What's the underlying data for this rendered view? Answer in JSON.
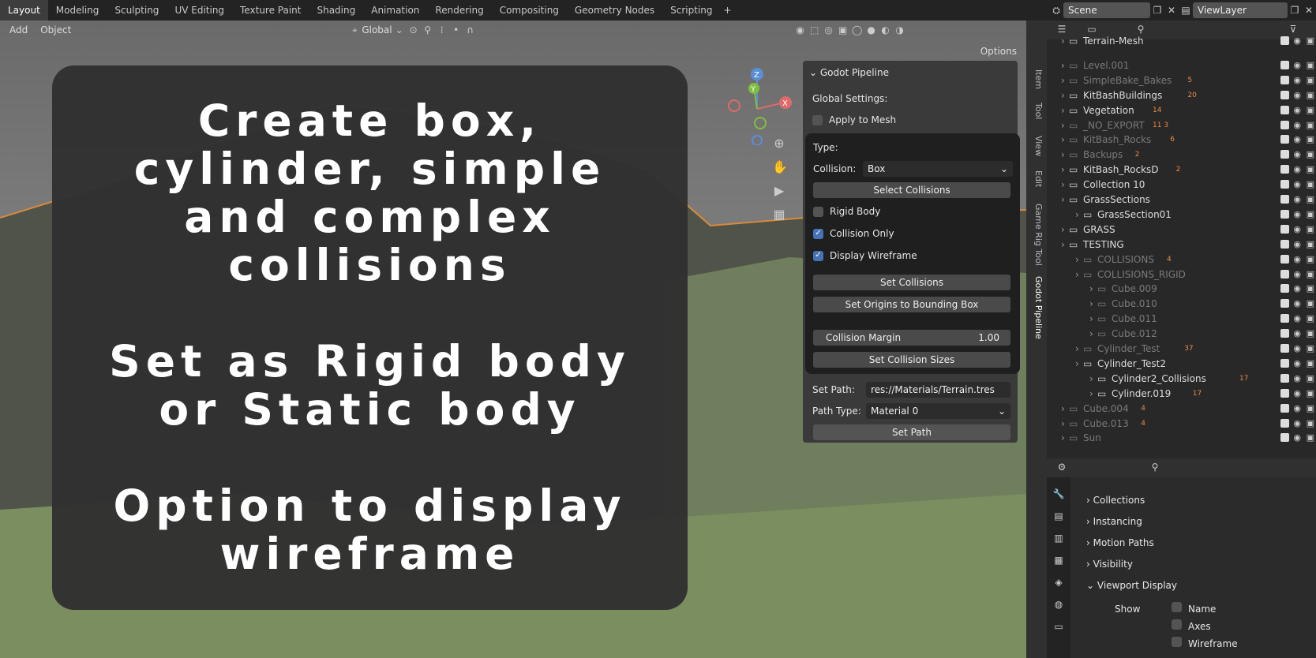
{
  "workspace_tabs": [
    "Layout",
    "Modeling",
    "Sculpting",
    "UV Editing",
    "Texture Paint",
    "Shading",
    "Animation",
    "Rendering",
    "Compositing",
    "Geometry Nodes",
    "Scripting"
  ],
  "add_tab_label": "+",
  "scene": "Scene",
  "view_layer": "ViewLayer",
  "viewport_menu": {
    "add": "Add",
    "object": "Object",
    "transform_orientation": "Global",
    "options": "Options"
  },
  "overlay_lines": [
    "Create box,",
    "cylinder, simple",
    "and complex",
    "collisions",
    "",
    "Set as Rigid body",
    "or Static body",
    "",
    "Option to display",
    "wireframe"
  ],
  "npanel": {
    "title": "Godot Pipeline",
    "global_settings": "Global Settings:",
    "apply_to_mesh": "Apply to Mesh",
    "type_label": "Type:",
    "collision_label": "Collision:",
    "collision_value": "Box",
    "select_collisions": "Select Collisions",
    "rigid_body": "Rigid Body",
    "collision_only": "Collision Only",
    "display_wireframe": "Display Wireframe",
    "set_collisions": "Set Collisions",
    "set_origins": "Set Origins to Bounding Box",
    "collision_margin_label": "Collision Margin",
    "collision_margin_value": "1.00",
    "set_collision_sizes": "Set Collision Sizes",
    "set_path_label": "Set Path:",
    "set_path_value": "res://Materials/Terrain.tres",
    "path_type_label": "Path Type:",
    "path_type_value": "Material 0",
    "set_path_button": "Set Path",
    "checks": {
      "apply_to_mesh": false,
      "rigid_body": false,
      "collision_only": true,
      "display_wireframe": true
    }
  },
  "side_tabs": [
    "Item",
    "Tool",
    "View",
    "Edit",
    "Game Rig Tool",
    "Godot Pipeline"
  ],
  "outliner": [
    {
      "name": "Terrain-Mesh",
      "dim": false
    },
    {
      "name": "Level.001",
      "dim": true
    },
    {
      "name": "SimpleBake_Bakes",
      "dim": true,
      "count": "5"
    },
    {
      "name": "KitBashBuildings",
      "dim": false,
      "count": "20"
    },
    {
      "name": "Vegetation",
      "dim": false,
      "count": "14"
    },
    {
      "name": "_NO_EXPORT",
      "dim": true,
      "count": "11 3"
    },
    {
      "name": "KitBash_Rocks",
      "dim": true,
      "count": "6"
    },
    {
      "name": "Backups",
      "dim": true,
      "count": "2"
    },
    {
      "name": "KitBash_RocksD",
      "dim": false,
      "count": "2"
    },
    {
      "name": "Collection 10",
      "dim": false
    },
    {
      "name": "GrassSections",
      "dim": false
    },
    {
      "name": "GrassSection01",
      "dim": false
    },
    {
      "name": "GRASS",
      "dim": false
    },
    {
      "name": "TESTING",
      "dim": false
    },
    {
      "name": "COLLISIONS",
      "dim": true,
      "count": "4"
    },
    {
      "name": "COLLISIONS_RIGID",
      "dim": true
    },
    {
      "name": "Cube.009",
      "dim": true
    },
    {
      "name": "Cube.010",
      "dim": true
    },
    {
      "name": "Cube.011",
      "dim": true
    },
    {
      "name": "Cube.012",
      "dim": true
    },
    {
      "name": "Cylinder_Test",
      "dim": true,
      "count": "37"
    },
    {
      "name": "Cylinder_Test2",
      "dim": false
    },
    {
      "name": "Cylinder2_Collisions",
      "dim": false,
      "count": "17"
    },
    {
      "name": "Cylinder.019",
      "dim": false,
      "count": "17"
    },
    {
      "name": "Cube.004",
      "dim": true,
      "count": "4"
    },
    {
      "name": "Cube.013",
      "dim": true,
      "count": "4"
    },
    {
      "name": "Sun",
      "dim": true
    }
  ],
  "properties": {
    "sections": [
      "Collections",
      "Instancing",
      "Motion Paths",
      "Visibility",
      "Viewport Display"
    ],
    "show_label": "Show",
    "show_items": [
      "Name",
      "Axes",
      "Wireframe"
    ]
  }
}
